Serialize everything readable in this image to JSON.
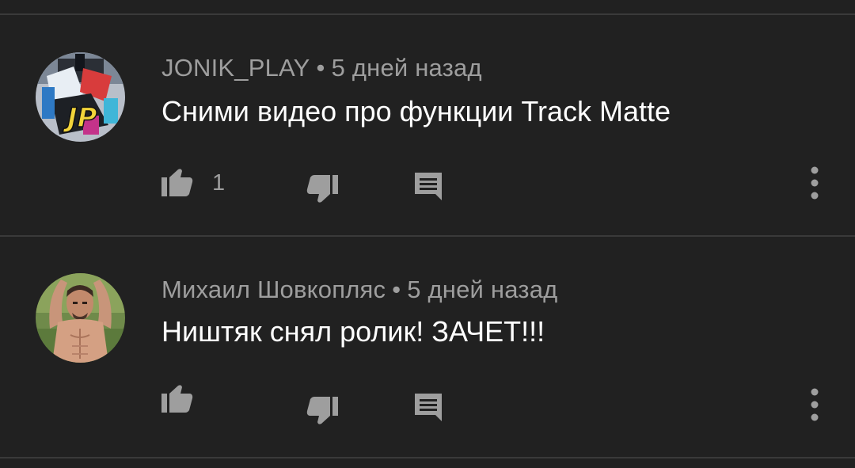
{
  "comments": [
    {
      "author": "JONIK_PLAY",
      "separator": "•",
      "time": "5 дней назад",
      "text": "Сними видео про функции Track Matte",
      "like_count": "1",
      "avatar_icon": "jp-logo-avatar",
      "avatar_letters": "JP"
    },
    {
      "author": "Михаил Шовкопляс",
      "separator": "•",
      "time": "5 дней назад",
      "text": "Ништяк снял ролик! ЗАЧЕТ!!!",
      "like_count": "",
      "avatar_icon": "person-photo-avatar"
    }
  ],
  "icons": {
    "like": "thumbs-up-icon",
    "dislike": "thumbs-down-icon",
    "reply": "reply-comment-icon",
    "menu": "more-vertical-icon"
  },
  "colors": {
    "background": "#212121",
    "divider": "#3a3a3a",
    "meta_text": "#9e9e9e",
    "comment_text": "#ffffff",
    "icon": "#9e9e9e"
  }
}
